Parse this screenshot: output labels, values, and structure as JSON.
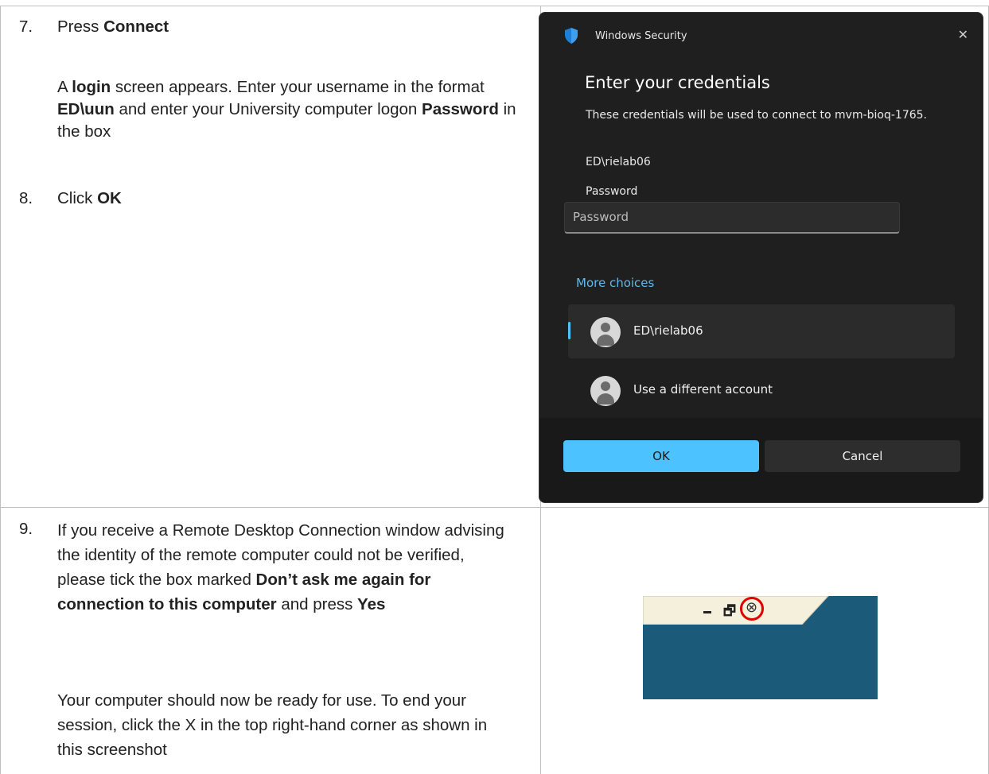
{
  "steps": {
    "s7": {
      "num": "7.",
      "lead": "Press ",
      "bold": "Connect"
    },
    "s7_para": {
      "t1": "A ",
      "b1": "login",
      "t2": " screen appears. Enter your username in the format ",
      "b2": "ED\\uun",
      "t3": " and enter your University computer logon ",
      "b3": "Password",
      "t4": " in the box"
    },
    "s8": {
      "num": "8.",
      "lead": "Click ",
      "bold": "OK"
    },
    "s9": {
      "num": "9.",
      "t1": "If you receive a Remote Desktop Connection window advising the identity of the remote computer could not be verified, please tick the box marked ",
      "b1": "Don’t ask me again for connection to this computer",
      "t2": " and press ",
      "b2": "Yes"
    },
    "s9_para": "Your computer should now be ready for use. To end your session, click the X in the top right-hand corner as shown in this screenshot"
  },
  "dialog": {
    "app_title": "Windows Security",
    "close_glyph": "✕",
    "heading": "Enter your credentials",
    "description": "These credentials will be used to connect to mvm-bioq-1765.",
    "username": "ED\\rielab06",
    "password_label": "Password",
    "password_placeholder": "Password",
    "more_choices": "More choices",
    "accounts": [
      {
        "label": "ED\\rielab06",
        "selected": true
      },
      {
        "label": "Use a different account",
        "selected": false
      }
    ],
    "ok_label": "OK",
    "cancel_label": "Cancel",
    "accent_color": "#4cc2ff"
  },
  "crop": {
    "minimize_icon": "minimize-icon",
    "restore_glyph": "🗗",
    "close_glyph": "⊗",
    "highlight_color": "#e00000"
  }
}
